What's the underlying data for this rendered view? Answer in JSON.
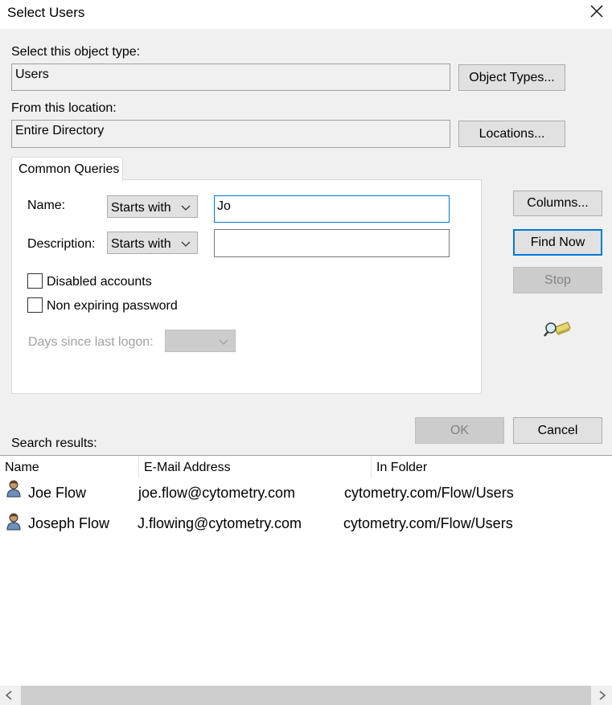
{
  "window": {
    "title": "Select Users"
  },
  "object_type": {
    "label": "Select this object type:",
    "value": "Users",
    "button": "Object Types..."
  },
  "location": {
    "label": "From this location:",
    "value": "Entire Directory",
    "button": "Locations..."
  },
  "tab": {
    "label": "Common Queries"
  },
  "query": {
    "name_label": "Name:",
    "name_mode": "Starts with",
    "name_value": "Jo",
    "desc_label": "Description:",
    "desc_mode": "Starts with",
    "desc_value": "",
    "disabled_accounts": "Disabled accounts",
    "non_expiring": "Non expiring password",
    "days_label": "Days since last logon:"
  },
  "buttons": {
    "columns": "Columns...",
    "find_now": "Find Now",
    "stop": "Stop",
    "ok": "OK",
    "cancel": "Cancel"
  },
  "results": {
    "label": "Search results:",
    "columns": [
      "Name",
      "E-Mail Address",
      "In Folder"
    ],
    "rows": [
      {
        "name": "Joe Flow",
        "email": "joe.flow@cytometry.com",
        "folder": "cytometry.com/Flow/Users"
      },
      {
        "name": "Joseph Flow",
        "email": "J.flowing@cytometry.com",
        "folder": "cytometry.com/Flow/Users"
      }
    ]
  },
  "icons": {
    "close": "close-icon",
    "search": "search-flashlight-icon",
    "user": "user-icon",
    "scroll_left": "chevron-left-icon",
    "scroll_right": "chevron-right-icon",
    "dropdown": "chevron-down-icon"
  },
  "colors": {
    "focus_accent": "#0078d7",
    "dialog_bg": "#f0f0f0"
  }
}
